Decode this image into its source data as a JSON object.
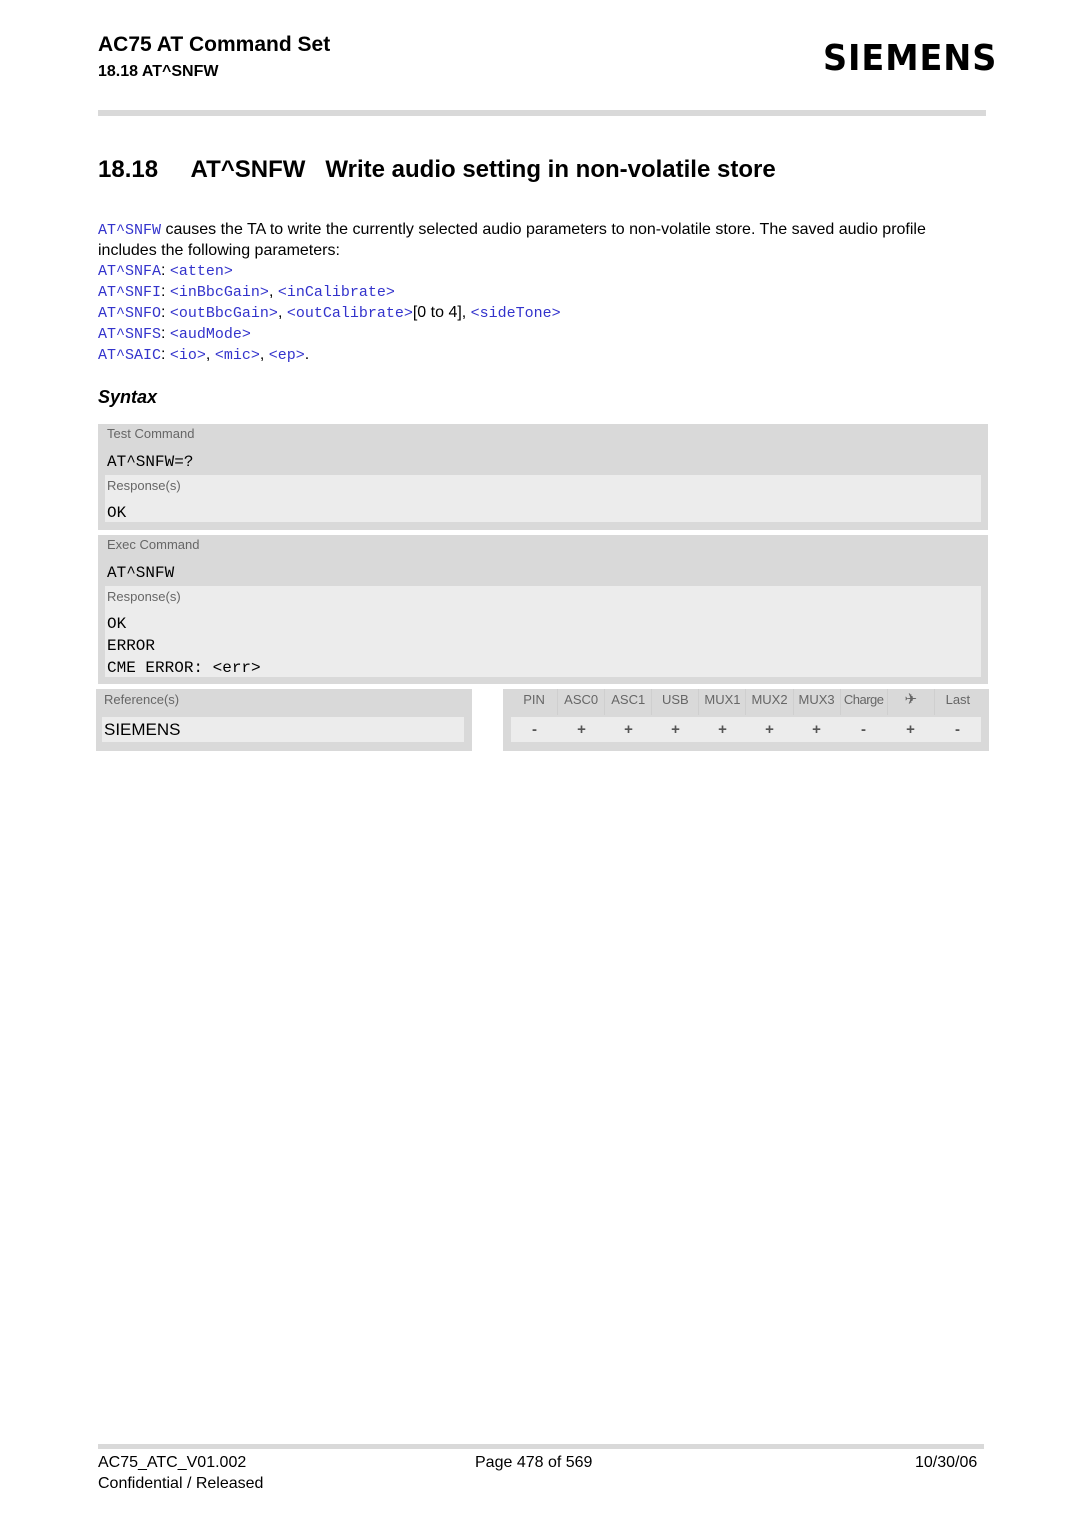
{
  "header": {
    "doc_title": "AC75 AT Command Set",
    "section_ref": "18.18 AT^SNFW",
    "logo": "SIEMENS"
  },
  "section": {
    "number": "18.18",
    "command": "AT^SNFW",
    "title": "Write audio setting in non-volatile store"
  },
  "intro": {
    "cmd_link": "AT^SNFW",
    "text": " causes the TA to write the currently selected audio parameters to non-volatile store. The saved audio profile includes the following parameters:"
  },
  "params": [
    {
      "cmd": "AT^SNFA",
      "sep": ": ",
      "args": [
        {
          "link": "<atten>",
          "after": ""
        }
      ]
    },
    {
      "cmd": "AT^SNFI",
      "sep": ": ",
      "args": [
        {
          "link": "<inBbcGain>",
          "after": ", "
        },
        {
          "link": "<inCalibrate>",
          "after": ""
        }
      ]
    },
    {
      "cmd": "AT^SNFO",
      "sep": ": ",
      "args": [
        {
          "link": "<outBbcGain>",
          "after": ", "
        },
        {
          "link": "<outCalibrate>",
          "after": "[0 to 4], "
        },
        {
          "link": "<sideTone>",
          "after": ""
        }
      ]
    },
    {
      "cmd": "AT^SNFS",
      "sep": ": ",
      "args": [
        {
          "link": "<audMode>",
          "after": ""
        }
      ]
    },
    {
      "cmd": "AT^SAIC",
      "sep": ": ",
      "args": [
        {
          "link": "<io>",
          "after": ", "
        },
        {
          "link": "<mic>",
          "after": ", "
        },
        {
          "link": "<ep>",
          "after": "."
        }
      ]
    }
  ],
  "syntax_heading": "Syntax",
  "test_command": {
    "label": "Test Command",
    "command": "AT^SNFW=?",
    "responses_label": "Response(s)",
    "responses": [
      "OK"
    ]
  },
  "exec_command": {
    "label": "Exec Command",
    "command": "AT^SNFW",
    "responses_label": "Response(s)",
    "responses": [
      "OK",
      "ERROR",
      "CME ERROR: <err>"
    ]
  },
  "references": {
    "label": "Reference(s)",
    "value": "SIEMENS"
  },
  "support_table": {
    "headers": [
      "PIN",
      "ASC0",
      "ASC1",
      "USB",
      "MUX1",
      "MUX2",
      "MUX3",
      "Charge",
      "airplane-icon",
      "Last"
    ],
    "values": [
      "-",
      "+",
      "+",
      "+",
      "+",
      "+",
      "+",
      "-",
      "+",
      "-"
    ]
  },
  "footer": {
    "doc_id": "AC75_ATC_V01.002",
    "page": "Page 478 of 569",
    "date": "10/30/06",
    "status": "Confidential / Released"
  }
}
